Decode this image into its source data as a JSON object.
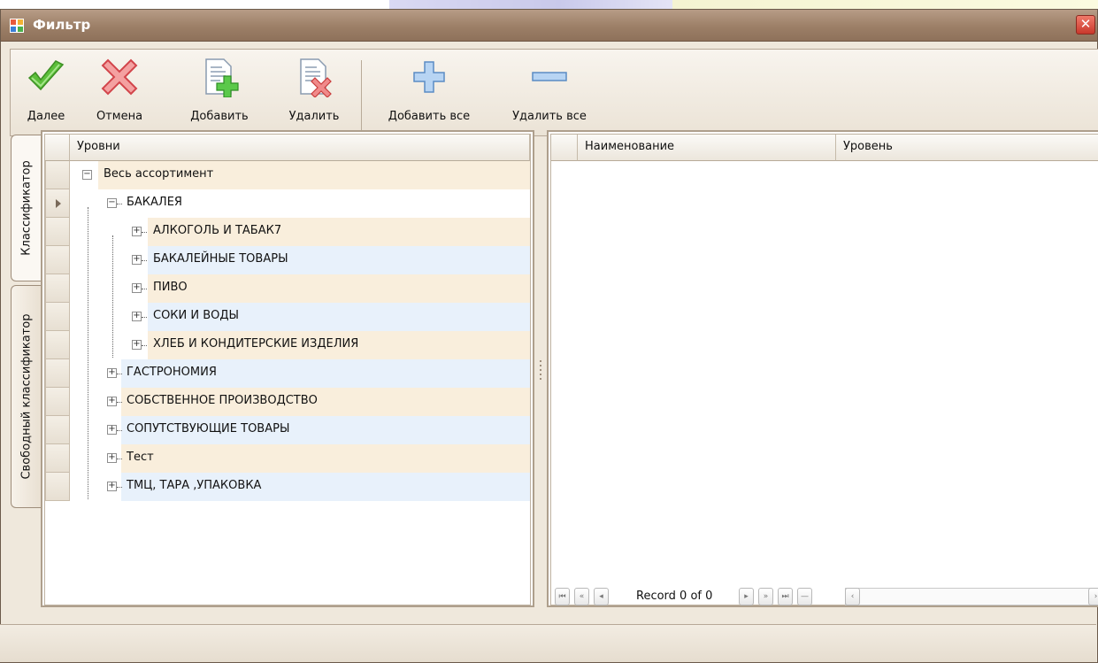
{
  "window": {
    "title": "Фильтр"
  },
  "toolbar": {
    "next_label": "Далее",
    "cancel_label": "Отмена",
    "add_label": "Добавить",
    "delete_label": "Удалить",
    "add_all_label": "Добавить все",
    "delete_all_label": "Удалить все"
  },
  "side_tabs": {
    "classifier": "Классификатор",
    "free_classifier": "Свободный классификатор"
  },
  "left_grid": {
    "column_header": "Уровни",
    "nodes": [
      {
        "label": "Весь ассортимент",
        "level": 0,
        "expanded": true
      },
      {
        "label": "БАКАЛЕЯ",
        "level": 1,
        "expanded": true,
        "selected": true
      },
      {
        "label": "АЛКОГОЛЬ И ТАБАК7",
        "level": 2,
        "expanded": false
      },
      {
        "label": "БАКАЛЕЙНЫЕ ТОВАРЫ",
        "level": 2,
        "expanded": false
      },
      {
        "label": "ПИВО",
        "level": 2,
        "expanded": false
      },
      {
        "label": "СОКИ И ВОДЫ",
        "level": 2,
        "expanded": false
      },
      {
        "label": "ХЛЕБ И КОНДИТЕРСКИЕ ИЗДЕЛИЯ",
        "level": 2,
        "expanded": false
      },
      {
        "label": "ГАСТРОНОМИЯ",
        "level": 1,
        "expanded": false
      },
      {
        "label": "СОБСТВЕННОЕ ПРОИЗВОДСТВО",
        "level": 1,
        "expanded": false
      },
      {
        "label": "СОПУТСТВУЮЩИЕ ТОВАРЫ",
        "level": 1,
        "expanded": false
      },
      {
        "label": "Тест",
        "level": 1,
        "expanded": false
      },
      {
        "label": "ТМЦ, ТАРА ,УПАКОВКА",
        "level": 1,
        "expanded": false
      }
    ]
  },
  "right_grid": {
    "columns": [
      "Наименование",
      "Уровень"
    ],
    "record_text": "Record 0 of 0"
  },
  "colors": {
    "row_odd": "#f9eedc",
    "row_even": "#e8f1fb",
    "title_bar": "#9c7f67",
    "close_button": "#d9483a"
  }
}
